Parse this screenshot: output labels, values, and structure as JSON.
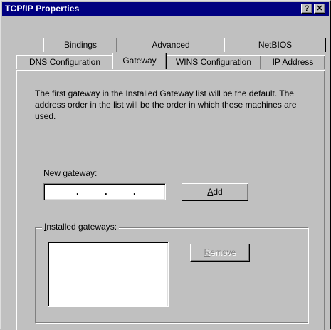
{
  "window": {
    "title": "TCP/IP Properties",
    "help_button": "?",
    "close_button": "✕"
  },
  "tabs": {
    "row_back": [
      "Bindings",
      "Advanced",
      "NetBIOS"
    ],
    "row_front": [
      "DNS Configuration",
      "Gateway",
      "WINS Configuration",
      "IP Address"
    ],
    "active": "Gateway"
  },
  "gateway": {
    "description": "The first gateway in the Installed Gateway list will be the default. The address order in the list will be the order in which these machines are used.",
    "new_gateway_label_mnemonic": "N",
    "new_gateway_label_rest": "ew gateway:",
    "ip_separator": ".",
    "add_button_mnemonic": "A",
    "add_button_rest": "dd",
    "installed_label_mnemonic": "I",
    "installed_label_rest": "nstalled gateways:",
    "installed_items": [],
    "remove_button_mnemonic": "R",
    "remove_button_rest": "emove",
    "remove_enabled": false
  }
}
